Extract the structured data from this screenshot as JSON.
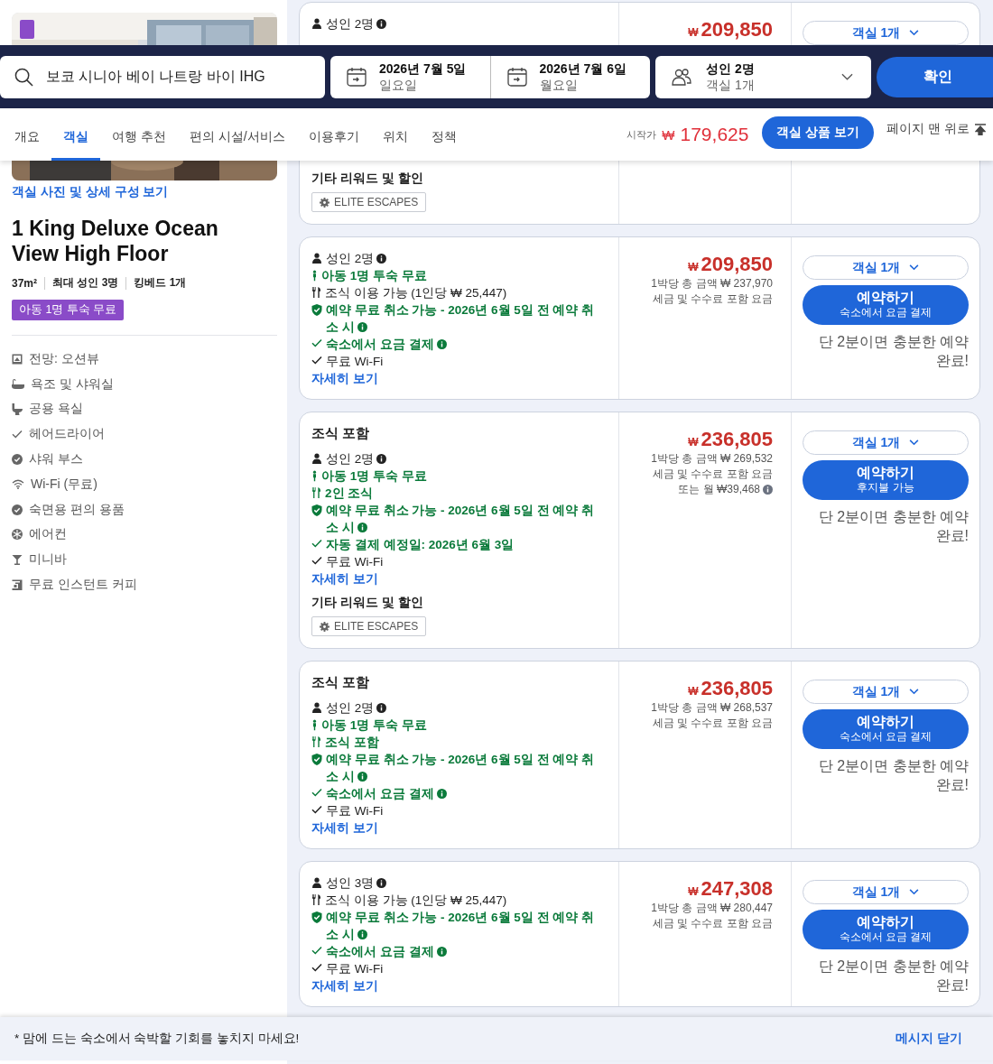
{
  "search_bar": {
    "destination": "보코 시니아 베이 나트랑 바이 IHG",
    "check_in": {
      "date": "2026년 7월 5일",
      "weekday": "일요일"
    },
    "check_out": {
      "date": "2026년 7월 6일",
      "weekday": "월요일"
    },
    "guests": {
      "adults": "성인 2명",
      "rooms": "객실 1개"
    },
    "confirm": "확인"
  },
  "nav": {
    "tabs": [
      {
        "label": "개요",
        "selected": false
      },
      {
        "label": "객실",
        "selected": true
      },
      {
        "label": "여행 추천",
        "selected": false
      },
      {
        "label": "편의 시설/서비스",
        "selected": false
      },
      {
        "label": "이용후기",
        "selected": false
      },
      {
        "label": "위치",
        "selected": false
      },
      {
        "label": "정책",
        "selected": false
      }
    ],
    "from_label": "시작가",
    "from_currency": "₩",
    "from_price": "179,625",
    "rooms_button": "객실 상품 보기",
    "top_link": "페이지 맨 위로"
  },
  "room": {
    "photos_link": "객실 사진 및 상세 구성 보기",
    "title": "1 King Deluxe Ocean View High Floor",
    "specs": [
      "37m²",
      "최대 성인 3명",
      "킹베드 1개"
    ],
    "badge": "아동 1명 투숙 무료",
    "amenities": [
      {
        "kind": "view",
        "label": "전망: 오션뷰"
      },
      {
        "kind": "bath",
        "label": "욕조 및 샤워실"
      },
      {
        "kind": "toilet",
        "label": "공용 욕실"
      },
      {
        "kind": "check",
        "label": "헤어드라이어"
      },
      {
        "kind": "badge",
        "label": "샤워 부스"
      },
      {
        "kind": "wifi",
        "label": "Wi-Fi (무료)"
      },
      {
        "kind": "badge",
        "label": "숙면용 편의 용품"
      },
      {
        "kind": "snow",
        "label": "에어컨"
      },
      {
        "kind": "cocktail",
        "label": "미니바"
      },
      {
        "kind": "coffee",
        "label": "무료 인스턴트 커피"
      }
    ]
  },
  "offers": [
    {
      "features": [
        {
          "kind": "guests",
          "text": "성인 2명",
          "emphasis": false,
          "info": true
        }
      ],
      "rewards": {
        "title": "기타 리워드 및 할인",
        "tags": [
          "ELITE ESCAPES"
        ]
      },
      "price": {
        "currency": "₩",
        "amount": "209,850"
      },
      "room_select": "객실 1개"
    },
    {
      "features": [
        {
          "kind": "guests",
          "text": "성인 2명",
          "emphasis": false,
          "info": true
        },
        {
          "kind": "child",
          "text": "아동 1명 투숙 무료",
          "emphasis": true,
          "info": false
        },
        {
          "kind": "meal",
          "text": "조식 이용 가능 (1인당 ₩ 25,447)",
          "emphasis": false,
          "info": false
        },
        {
          "kind": "cancel",
          "text": "예약 무료 취소 가능 - 2026년 6월 5일 전 예약 취소 시",
          "emphasis": true,
          "info": true
        },
        {
          "kind": "check",
          "text": "숙소에서 요금 결제",
          "emphasis": true,
          "info": true
        },
        {
          "kind": "check",
          "text": "무료 Wi-Fi",
          "emphasis": false,
          "info": false
        }
      ],
      "details_link": "자세히 보기",
      "price": {
        "currency": "₩",
        "amount": "209,850",
        "total": "1박당 총 금액 ₩ 237,970",
        "tax": "세금 및 수수료 포함 요금"
      },
      "room_select": "객실 1개",
      "book": {
        "title": "예약하기",
        "subtitle": "숙소에서 요금 결제"
      },
      "note": "단 2분이면 충분한 예약 완료!"
    },
    {
      "heading": "조식 포함",
      "features": [
        {
          "kind": "guests",
          "text": "성인 2명",
          "emphasis": false,
          "info": true
        },
        {
          "kind": "child",
          "text": "아동 1명 투숙 무료",
          "emphasis": true,
          "info": false
        },
        {
          "kind": "meal",
          "text": "2인 조식",
          "emphasis": true,
          "info": false
        },
        {
          "kind": "cancel",
          "text": "예약 무료 취소 가능 - 2026년 6월 5일 전 예약 취소 시",
          "emphasis": true,
          "info": true
        },
        {
          "kind": "check",
          "text": "자동 결제 예정일: 2026년 6월 3일",
          "emphasis": true,
          "info": false
        },
        {
          "kind": "check",
          "text": "무료 Wi-Fi",
          "emphasis": false,
          "info": false
        }
      ],
      "details_link": "자세히 보기",
      "rewards": {
        "title": "기타 리워드 및 할인",
        "tags": [
          "ELITE ESCAPES"
        ]
      },
      "price": {
        "currency": "₩",
        "amount": "236,805",
        "total": "1박당 총 금액 ₩ 269,532",
        "tax": "세금 및 수수료 포함 요금",
        "monthly": "또는 월 ₩39,468"
      },
      "room_select": "객실 1개",
      "book": {
        "title": "예약하기",
        "subtitle": "후지불 가능"
      },
      "note": "단 2분이면 충분한 예약 완료!"
    },
    {
      "heading": "조식 포함",
      "features": [
        {
          "kind": "guests",
          "text": "성인 2명",
          "emphasis": false,
          "info": true
        },
        {
          "kind": "child",
          "text": "아동 1명 투숙 무료",
          "emphasis": true,
          "info": false
        },
        {
          "kind": "meal",
          "text": "조식 포함",
          "emphasis": true,
          "info": false
        },
        {
          "kind": "cancel",
          "text": "예약 무료 취소 가능 - 2026년 6월 5일 전 예약 취소 시",
          "emphasis": true,
          "info": true
        },
        {
          "kind": "check",
          "text": "숙소에서 요금 결제",
          "emphasis": true,
          "info": true
        },
        {
          "kind": "check",
          "text": "무료 Wi-Fi",
          "emphasis": false,
          "info": false
        }
      ],
      "details_link": "자세히 보기",
      "price": {
        "currency": "₩",
        "amount": "236,805",
        "total": "1박당 총 금액 ₩ 268,537",
        "tax": "세금 및 수수료 포함 요금"
      },
      "room_select": "객실 1개",
      "book": {
        "title": "예약하기",
        "subtitle": "숙소에서 요금 결제"
      },
      "note": "단 2분이면 충분한 예약 완료!"
    },
    {
      "features": [
        {
          "kind": "guests",
          "text": "성인 3명",
          "emphasis": false,
          "info": true
        },
        {
          "kind": "meal",
          "text": "조식 이용 가능 (1인당 ₩ 25,447)",
          "emphasis": false,
          "info": false
        },
        {
          "kind": "cancel",
          "text": "예약 무료 취소 가능 - 2026년 6월 5일 전 예약 취소 시",
          "emphasis": true,
          "info": true
        },
        {
          "kind": "check",
          "text": "숙소에서 요금 결제",
          "emphasis": true,
          "info": true
        },
        {
          "kind": "check",
          "text": "무료 Wi-Fi",
          "emphasis": false,
          "info": false
        }
      ],
      "details_link": "자세히 보기",
      "price": {
        "currency": "₩",
        "amount": "247,308",
        "total": "1박당 총 금액 ₩ 280,447",
        "tax": "세금 및 수수료 포함 요금"
      },
      "room_select": "객실 1개",
      "book": {
        "title": "예약하기",
        "subtitle": "숙소에서 요금 결제"
      },
      "note": "단 2분이면 충분한 예약 완료!"
    }
  ],
  "message_bar": {
    "text": "* 맘에 드는 숙소에서 숙박할 기회를 놓치지 마세요!",
    "close": "메시지 닫기"
  }
}
